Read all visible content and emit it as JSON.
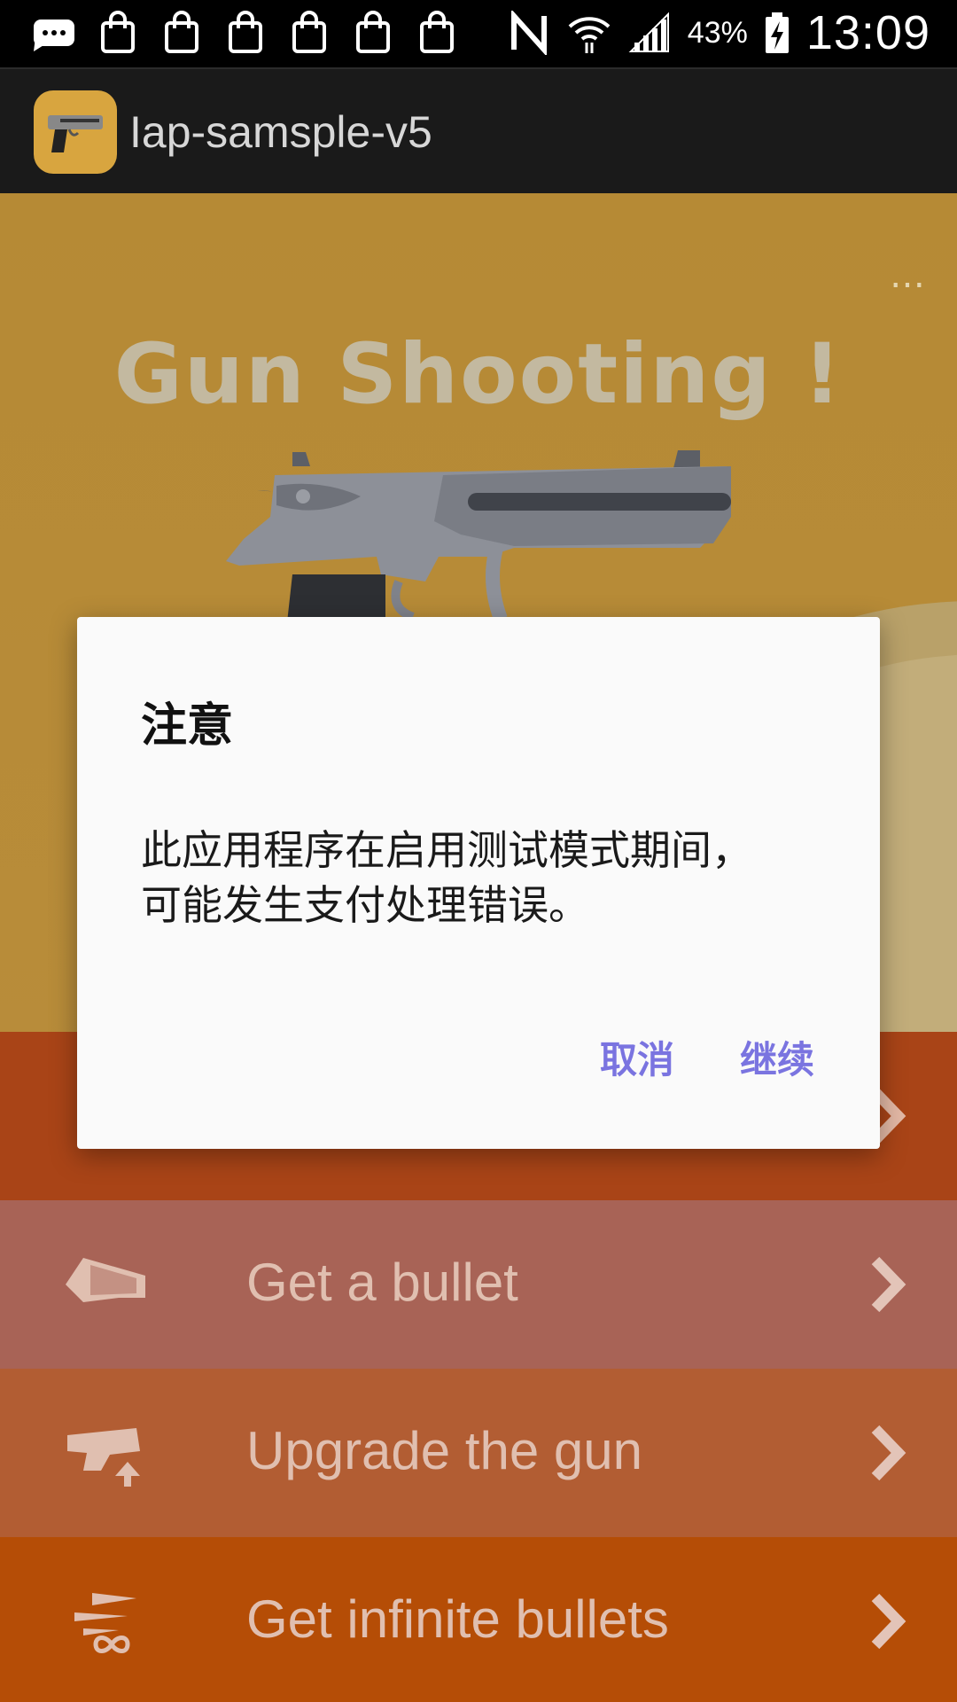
{
  "status_bar": {
    "icons_left": [
      "message-icon",
      "shopping-bag-icon",
      "shopping-bag-icon",
      "shopping-bag-icon",
      "shopping-bag-icon",
      "shopping-bag-icon",
      "shopping-bag-icon"
    ],
    "icons_right": [
      "nfc-icon",
      "wifi-icon",
      "signal-icon"
    ],
    "battery_percent": "43%",
    "time": "13:09"
  },
  "app_bar": {
    "title": "Iap-samsple-v5",
    "icon": "app-gun-icon"
  },
  "main": {
    "overflow_menu": "…",
    "game_title": "Gun Shooting !",
    "menu": [
      {
        "label": "",
        "icon": "hidden-row-icon",
        "color": "#a94417"
      },
      {
        "label": "Get a bullet",
        "icon": "bullet-icon",
        "color": "#a86356"
      },
      {
        "label": "Upgrade the gun",
        "icon": "gun-upgrade-icon",
        "color": "#b25d33"
      },
      {
        "label": "Get infinite bullets",
        "icon": "infinite-bullets-icon",
        "color": "#b54d06"
      }
    ]
  },
  "dialog": {
    "title": "注意",
    "message": "此应用程序在启用测试模式期间，可能发生支付处理错误。",
    "cancel_label": "取消",
    "continue_label": "继续"
  },
  "colors": {
    "background": "#b68a35",
    "dialog_button": "#7a74e0",
    "app_bar": "#1a1a1a"
  }
}
